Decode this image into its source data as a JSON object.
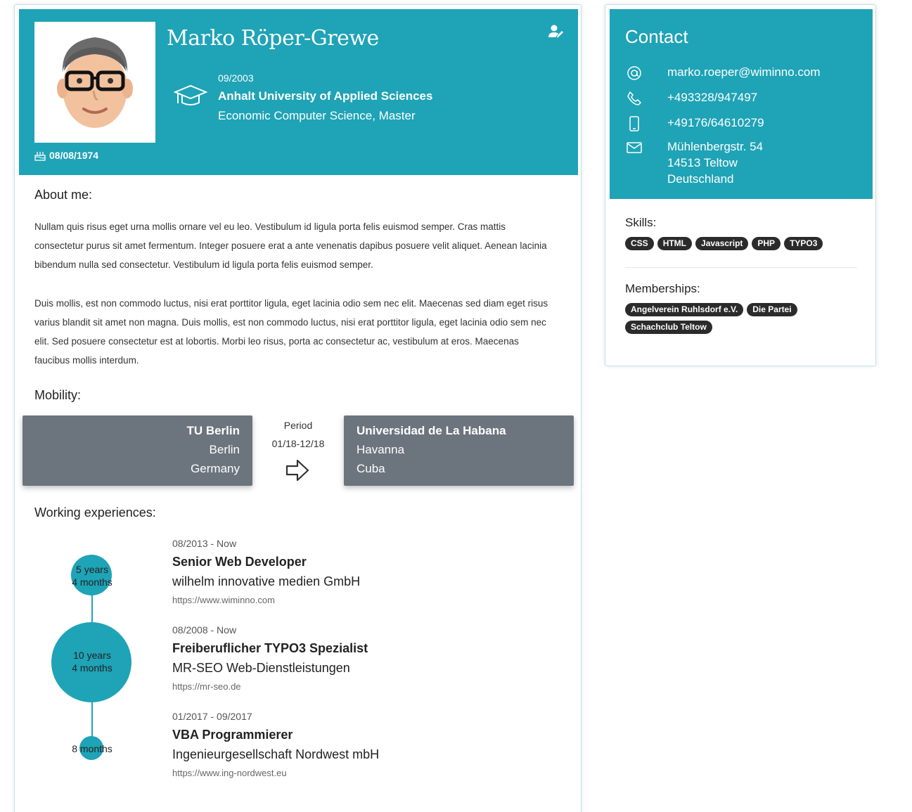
{
  "profile": {
    "name": "Marko Röper-Grewe",
    "birthdate": "08/08/1974",
    "education": {
      "date": "09/2003",
      "school": "Anhalt University of Applied Sciences",
      "degree": "Economic Computer Science, Master"
    }
  },
  "about": {
    "title": "About me:",
    "paragraphs": [
      "Nullam quis risus eget urna mollis ornare vel eu leo. Vestibulum id ligula porta felis euismod semper. Cras mattis consectetur purus sit amet fermentum. Integer posuere erat a ante venenatis dapibus posuere velit aliquet. Aenean lacinia bibendum nulla sed consectetur. Vestibulum id ligula porta felis euismod semper.",
      "Duis mollis, est non commodo luctus, nisi erat porttitor ligula, eget lacinia odio sem nec elit. Maecenas sed diam eget risus varius blandit sit amet non magna. Duis mollis, est non commodo luctus, nisi erat porttitor ligula, eget lacinia odio sem nec elit. Sed posuere consectetur est at lobortis. Morbi leo risus, porta ac consectetur ac, vestibulum at eros. Maecenas faucibus mollis interdum."
    ]
  },
  "mobility": {
    "title": "Mobility:",
    "from": {
      "institution": "TU Berlin",
      "city": "Berlin",
      "country": "Germany"
    },
    "period_label": "Period",
    "period": "01/18-12/18",
    "to": {
      "institution": "Universidad de La Habana",
      "city": "Havanna",
      "country": "Cuba"
    }
  },
  "work": {
    "title": "Working experiences:",
    "jobs": [
      {
        "date": "08/2013 - Now",
        "title": "Senior Web Developer",
        "company": "wilhelm innovative medien GmbH",
        "url": "https://www.wiminno.com",
        "duration_line1": "5 years",
        "duration_line2": "4 months"
      },
      {
        "date": "08/2008 - Now",
        "title": "Freiberuflicher TYPO3 Spezialist",
        "company": "MR-SEO Web-Dienstleistungen",
        "url": "https://mr-seo.de",
        "duration_line1": "10 years",
        "duration_line2": "4 months"
      },
      {
        "date": "01/2017 - 09/2017",
        "title": "VBA Programmierer",
        "company": "Ingenieurgesellschaft Nordwest mbH",
        "url": "https://www.ing-nordwest.eu",
        "duration_line1": "8 months",
        "duration_line2": ""
      }
    ]
  },
  "contact": {
    "title": "Contact",
    "email": "marko.roeper@wiminno.com",
    "phone": "+493328/947497",
    "mobile": "+49176/64610279",
    "address_line1": "Mühlenbergstr. 54",
    "address_line2": "14513 Teltow",
    "address_line3": "Deutschland"
  },
  "skills": {
    "title": "Skills:",
    "items": [
      "CSS",
      "HTML",
      "Javascript",
      "PHP",
      "TYPO3"
    ]
  },
  "memberships": {
    "title": "Memberships:",
    "items": [
      "Angelverein Ruhlsdorf e.V.",
      "Die Partei",
      "Schachclub Teltow"
    ]
  },
  "colors": {
    "accent": "#1fa3b6",
    "mobility_box": "#6c757d",
    "tag": "#2b2b2b"
  }
}
